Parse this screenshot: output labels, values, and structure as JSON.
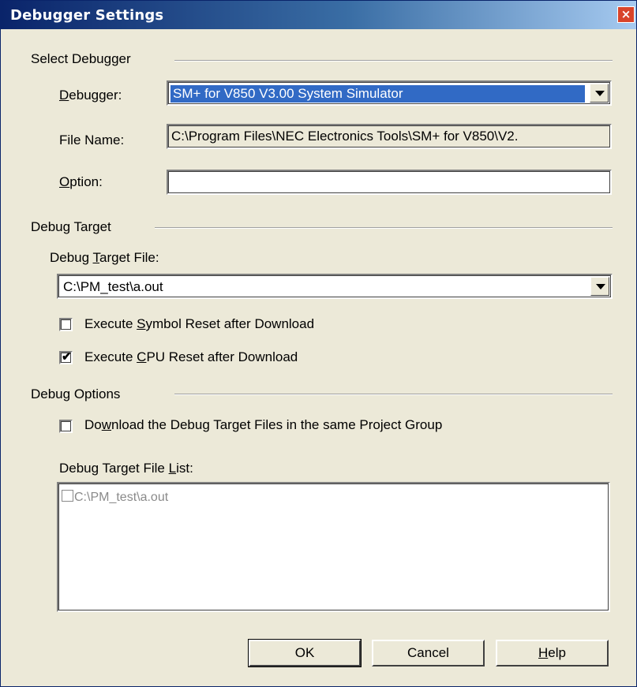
{
  "window": {
    "title": "Debugger Settings",
    "close_glyph": "×"
  },
  "select_debugger": {
    "section_title": "Select Debugger",
    "debugger_label_pre": "",
    "debugger_label_key": "D",
    "debugger_label_post": "ebugger:",
    "debugger_value": "SM+ for V850 V3.00 System Simulator",
    "file_name_label": "File Name:",
    "file_name_value": "C:\\Program Files\\NEC Electronics Tools\\SM+ for V850\\V2.",
    "option_label_key": "O",
    "option_label_post": "ption:",
    "option_value": ""
  },
  "debug_target": {
    "section_title": "Debug Target",
    "file_label_pre": "Debug ",
    "file_label_key": "T",
    "file_label_post": "arget File:",
    "file_value": "C:\\PM_test\\a.out",
    "symbol_reset": {
      "pre": "Execute ",
      "key": "S",
      "post": "ymbol Reset after Download",
      "checked": false
    },
    "cpu_reset": {
      "pre": "Execute ",
      "key": "C",
      "post": "PU Reset after Download",
      "checked": true,
      "check_glyph": "✔"
    }
  },
  "debug_options": {
    "section_title": "Debug Options",
    "download_same_group": {
      "pre": "Do",
      "key": "w",
      "post": "nload the Debug Target Files in the same Project Group",
      "checked": false
    },
    "list_label_pre": "Debug Target File ",
    "list_label_key": "L",
    "list_label_post": "ist:",
    "list_items": [
      "C:\\PM_test\\a.out"
    ]
  },
  "buttons": {
    "ok": "OK",
    "cancel": "Cancel",
    "help_key": "H",
    "help_post": "elp"
  }
}
